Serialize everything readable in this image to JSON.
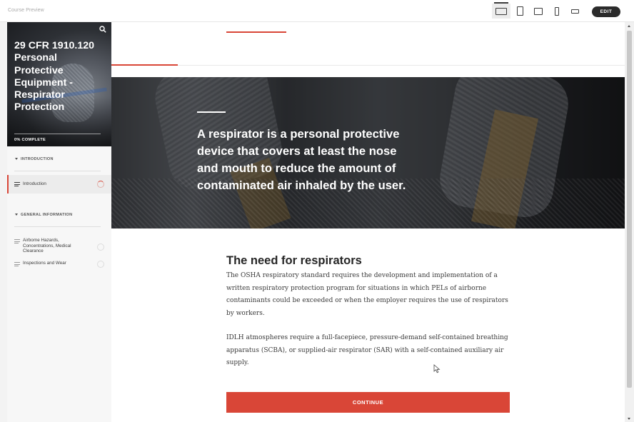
{
  "app": {
    "preview_label": "Course Preview",
    "edit_label": "EDIT",
    "device_icons": [
      "desktop-icon",
      "tablet-portrait-icon",
      "tablet-landscape-icon",
      "phone-portrait-icon",
      "phone-landscape-icon"
    ]
  },
  "sidebar": {
    "course_title": "29 CFR 1910.120 Personal Protective Equipment - Respirator Protection",
    "progress_text": "0% COMPLETE",
    "progress_percent": 0,
    "sections": [
      {
        "title": "INTRODUCTION",
        "lessons": [
          {
            "label": "Introduction",
            "active": true
          }
        ]
      },
      {
        "title": "GENERAL INFORMATION",
        "lessons": [
          {
            "label": "Airborne Hazards, Concentrations, Medical Clearance",
            "active": false
          },
          {
            "label": "Inspections and Wear",
            "active": false
          }
        ]
      }
    ]
  },
  "main": {
    "hero_quote": "A respirator is a personal protective device that covers at least the nose and mouth to reduce the amount of contaminated air inhaled by the user.",
    "content_title": "The need for respirators",
    "paragraphs": [
      "The OSHA respiratory standard requires the development and implementation of a written respiratory protection program for situations in which PELs of airborne contaminants could be exceeded or when the employer requires the use of respirators by workers.",
      "IDLH atmospheres require a full-facepiece, pressure-demand self-contained breathing apparatus (SCBA), or supplied-air respirator (SAR) with a self-contained auxiliary air supply."
    ],
    "continue_label": "CONTINUE"
  },
  "colors": {
    "accent": "#d94637",
    "edit_button": "#2b2b2b",
    "sidebar_bg": "#f7f7f7"
  }
}
